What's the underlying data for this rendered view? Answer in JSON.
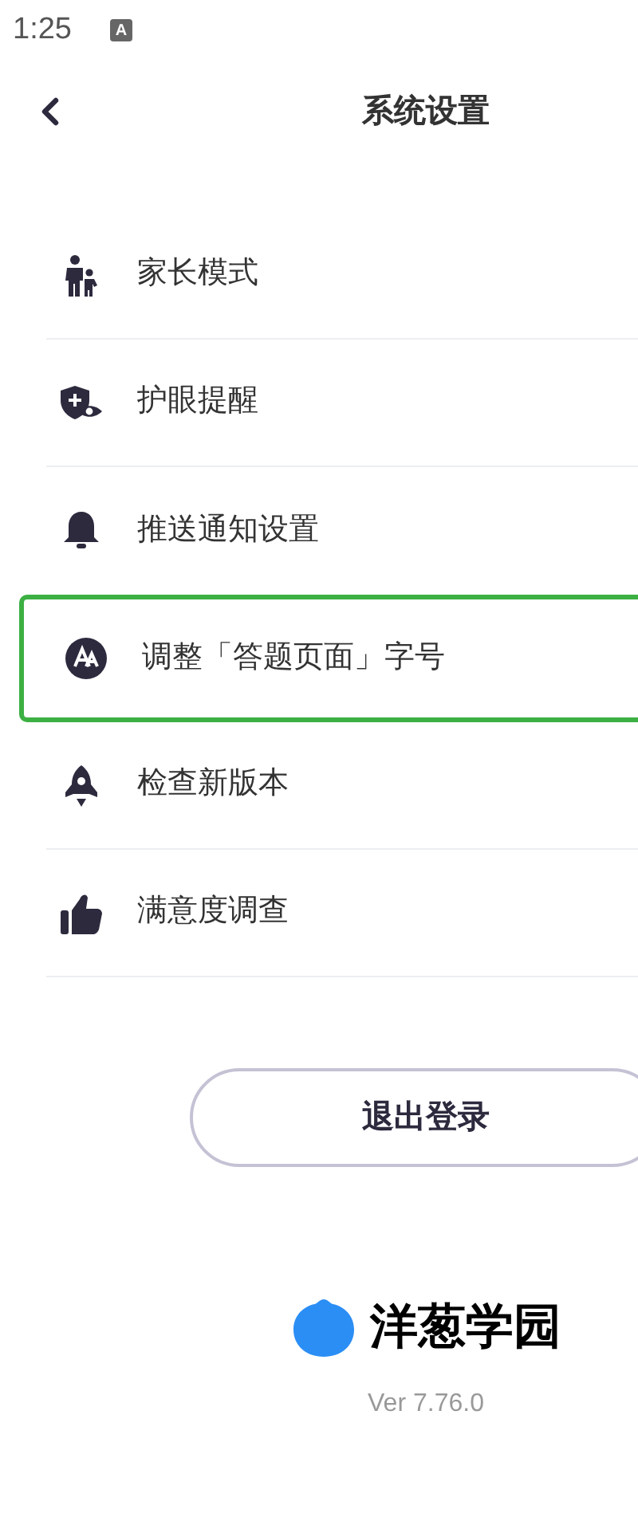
{
  "status_bar": {
    "time": "1:25",
    "notification_glyph": "A"
  },
  "header": {
    "title": "系统设置"
  },
  "items": [
    {
      "kind": "parent",
      "label": "家长模式",
      "selected": false
    },
    {
      "kind": "eye",
      "label": "护眼提醒",
      "selected": false
    },
    {
      "kind": "bell",
      "label": "推送通知设置",
      "selected": false
    },
    {
      "kind": "font",
      "label": "调整「答题页面」字号",
      "selected": true
    },
    {
      "kind": "rocket",
      "label": "检查新版本",
      "selected": false
    },
    {
      "kind": "thumb",
      "label": "满意度调查",
      "selected": false
    }
  ],
  "logout_button": "退出登录",
  "brand": {
    "name": "洋葱学园",
    "version": "Ver 7.76.0"
  }
}
